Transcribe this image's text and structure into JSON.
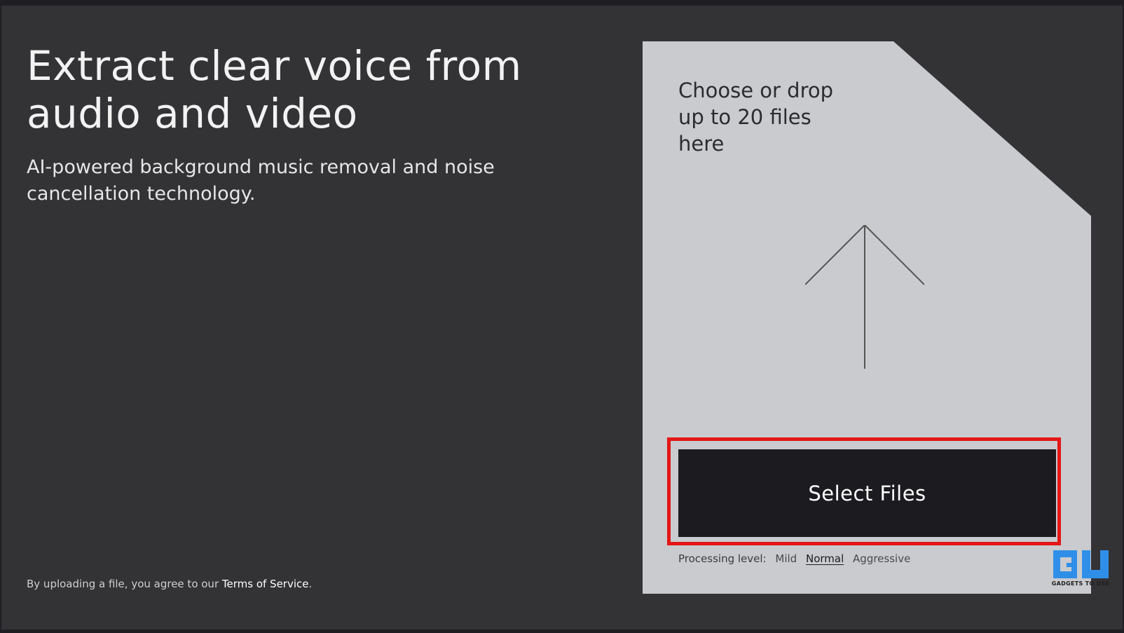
{
  "hero": {
    "title": "Extract clear voice from audio and video",
    "subtitle": "AI-powered background music removal and noise cancellation technology."
  },
  "dropzone": {
    "prompt": "Choose or drop up to 20 files here",
    "upload_icon": "arrow-up-icon",
    "button_label": "Select Files",
    "highlight_color": "#e41616"
  },
  "processing": {
    "label": "Processing level:",
    "options": [
      "Mild",
      "Normal",
      "Aggressive"
    ],
    "selected": "Normal"
  },
  "footer": {
    "prefix": "By uploading a file, you agree to our ",
    "link": "Terms of Service",
    "suffix": "."
  },
  "watermark": {
    "text": "GADGETS TO USE",
    "accent": "#2f8fe8"
  },
  "colors": {
    "page_bg": "#333235",
    "card_bg": "#c9cbce",
    "button_bg": "#1c1b1f",
    "text_light": "#f2f2f2"
  }
}
